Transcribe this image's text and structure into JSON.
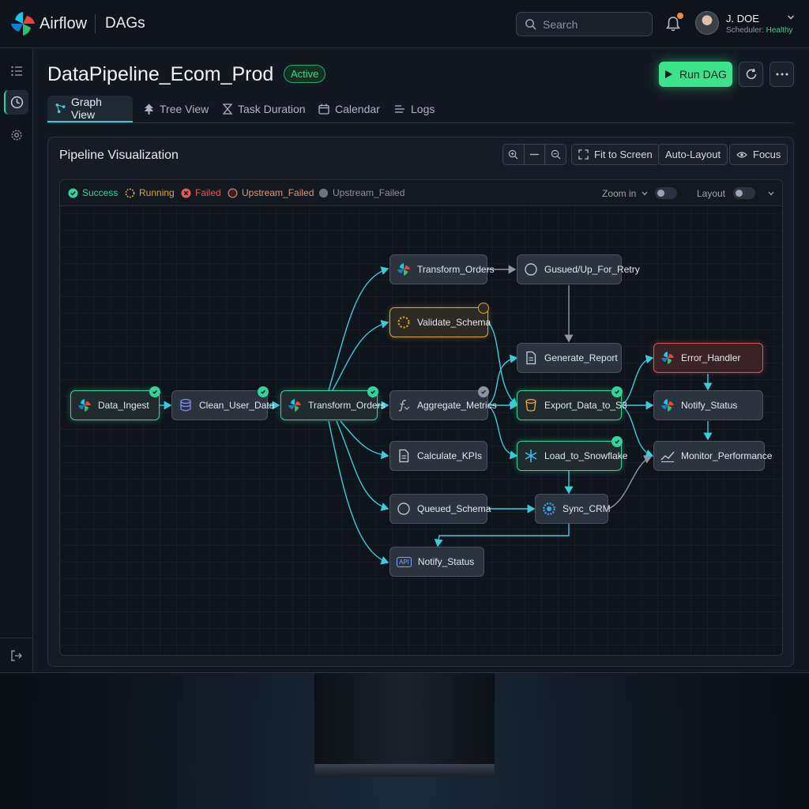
{
  "app": {
    "brand": "Airflow",
    "section": "DAGs"
  },
  "search": {
    "placeholder": "Search"
  },
  "user": {
    "name": "J. DOE",
    "status_label": "Scheduler:",
    "status_value": "Healthy"
  },
  "dag": {
    "title": "DataPipeline_Ecom_Prod",
    "status": "Active"
  },
  "actions": {
    "run_label": "Run DAG"
  },
  "tabs": [
    {
      "label": "Graph View",
      "icon": "graph-icon"
    },
    {
      "label": "Tree View",
      "icon": "tree-icon"
    },
    {
      "label": "Task Duration",
      "icon": "hourglass-icon"
    },
    {
      "label": "Calendar",
      "icon": "calendar-icon"
    },
    {
      "label": "Logs",
      "icon": "logs-icon"
    }
  ],
  "panel": {
    "title": "Pipeline Visualization",
    "fit_label": "Fit to Screen",
    "autolayout_label": "Auto-Layout",
    "focus_label": "Focus",
    "zoom_label": "Zoom in",
    "layout_label": "Layout"
  },
  "legend": [
    {
      "label": "Success",
      "color": "#34d399"
    },
    {
      "label": "Running",
      "color": "#e0a630"
    },
    {
      "label": "Failed",
      "color": "#e25b57"
    },
    {
      "label": "Upstream_Failed",
      "color": "#c77a5e"
    },
    {
      "label": "Upstream_Failed",
      "color": "#8a94a1"
    }
  ],
  "nodes": {
    "data_ingest": "Data_Ingest",
    "clean_user_data": "Clean_User_Data",
    "transform_orders_main": "Transform_Orders",
    "transform_orders_top": "Transform_Orders",
    "gusued": "Gusued/Up_For_Retry",
    "validate_schema": "Validate_Schema",
    "generate_report": "Generate_Report",
    "error_handler": "Error_Handler",
    "aggregate_metrics": "Aggregate_Metrics",
    "export_s3": "Export_Data_to_S3",
    "notify_status_right": "Notify_Status",
    "calculate_kpis": "Calculate_KPIs",
    "load_snowflake": "Load_to_Snowflake",
    "monitor_performance": "Monitor_Performance",
    "queued_schema": "Queued_Schema",
    "sync_crm": "Sync_CRM",
    "notify_status_bottom": "Notify_Status",
    "api_badge": "API"
  },
  "colors": {
    "accent": "#3ee28a",
    "edge": "#3ecbd8",
    "success": "#34d399",
    "running": "#e0a630",
    "failed": "#d9534f"
  }
}
